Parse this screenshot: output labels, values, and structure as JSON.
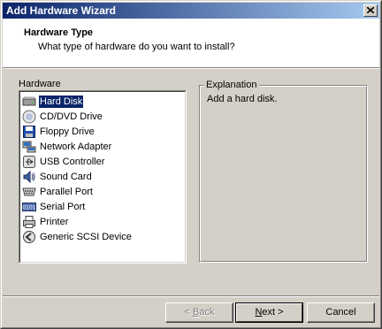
{
  "window": {
    "title": "Add Hardware Wizard"
  },
  "header": {
    "title": "Hardware Type",
    "subtitle": "What type of hardware do you want to install?"
  },
  "hardware": {
    "label": "Hardware",
    "selected_index": 0,
    "items": [
      {
        "label": "Hard Disk",
        "icon": "hard-disk-icon"
      },
      {
        "label": "CD/DVD Drive",
        "icon": "cd-dvd-drive-icon"
      },
      {
        "label": "Floppy Drive",
        "icon": "floppy-drive-icon"
      },
      {
        "label": "Network Adapter",
        "icon": "network-adapter-icon"
      },
      {
        "label": "USB Controller",
        "icon": "usb-controller-icon"
      },
      {
        "label": "Sound Card",
        "icon": "sound-card-icon"
      },
      {
        "label": "Parallel Port",
        "icon": "parallel-port-icon"
      },
      {
        "label": "Serial Port",
        "icon": "serial-port-icon"
      },
      {
        "label": "Printer",
        "icon": "printer-icon"
      },
      {
        "label": "Generic SCSI Device",
        "icon": "scsi-device-icon"
      }
    ]
  },
  "explanation": {
    "label": "Explanation",
    "text": "Add a hard disk."
  },
  "buttons": {
    "back": {
      "label_prefix": "< ",
      "mnemonic": "B",
      "label_rest": "ack",
      "enabled": false
    },
    "next": {
      "mnemonic": "N",
      "label_rest": "ext >",
      "enabled": true
    },
    "cancel": {
      "label": "Cancel",
      "enabled": true
    }
  },
  "colors": {
    "title_gradient_start": "#0a246a",
    "title_gradient_end": "#a6caf0",
    "selection": "#0a246a",
    "face": "#d4d0c8"
  }
}
